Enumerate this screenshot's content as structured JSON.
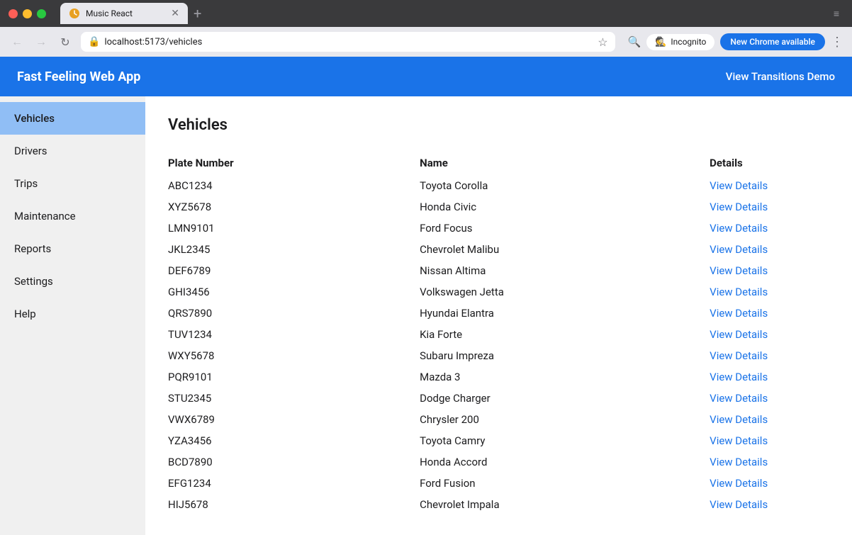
{
  "browser": {
    "tab_title": "Music React",
    "tab_favicon": "music-icon",
    "url": "localhost:5173/vehicles",
    "nav": {
      "back": "←",
      "forward": "→",
      "reload": "↻"
    },
    "new_tab_icon": "+",
    "incognito_label": "Incognito",
    "new_chrome_label": "New Chrome available",
    "more_icon": "⋮"
  },
  "app": {
    "title": "Fast Feeling Web App",
    "view_transitions_label": "View Transitions Demo",
    "header_bg": "#1a73e8"
  },
  "sidebar": {
    "items": [
      {
        "id": "vehicles",
        "label": "Vehicles",
        "active": true
      },
      {
        "id": "drivers",
        "label": "Drivers",
        "active": false
      },
      {
        "id": "trips",
        "label": "Trips",
        "active": false
      },
      {
        "id": "maintenance",
        "label": "Maintenance",
        "active": false
      },
      {
        "id": "reports",
        "label": "Reports",
        "active": false
      },
      {
        "id": "settings",
        "label": "Settings",
        "active": false
      },
      {
        "id": "help",
        "label": "Help",
        "active": false
      }
    ]
  },
  "vehicles_page": {
    "title": "Vehicles",
    "columns": [
      "Plate Number",
      "Name",
      "Details"
    ],
    "rows": [
      {
        "plate": "ABC1234",
        "name": "Toyota Corolla",
        "details_label": "View Details"
      },
      {
        "plate": "XYZ5678",
        "name": "Honda Civic",
        "details_label": "View Details"
      },
      {
        "plate": "LMN9101",
        "name": "Ford Focus",
        "details_label": "View Details"
      },
      {
        "plate": "JKL2345",
        "name": "Chevrolet Malibu",
        "details_label": "View Details"
      },
      {
        "plate": "DEF6789",
        "name": "Nissan Altima",
        "details_label": "View Details"
      },
      {
        "plate": "GHI3456",
        "name": "Volkswagen Jetta",
        "details_label": "View Details"
      },
      {
        "plate": "QRS7890",
        "name": "Hyundai Elantra",
        "details_label": "View Details"
      },
      {
        "plate": "TUV1234",
        "name": "Kia Forte",
        "details_label": "View Details"
      },
      {
        "plate": "WXY5678",
        "name": "Subaru Impreza",
        "details_label": "View Details"
      },
      {
        "plate": "PQR9101",
        "name": "Mazda 3",
        "details_label": "View Details"
      },
      {
        "plate": "STU2345",
        "name": "Dodge Charger",
        "details_label": "View Details"
      },
      {
        "plate": "VWX6789",
        "name": "Chrysler 200",
        "details_label": "View Details"
      },
      {
        "plate": "YZA3456",
        "name": "Toyota Camry",
        "details_label": "View Details"
      },
      {
        "plate": "BCD7890",
        "name": "Honda Accord",
        "details_label": "View Details"
      },
      {
        "plate": "EFG1234",
        "name": "Ford Fusion",
        "details_label": "View Details"
      },
      {
        "plate": "HIJ5678",
        "name": "Chevrolet Impala",
        "details_label": "View Details"
      }
    ]
  }
}
